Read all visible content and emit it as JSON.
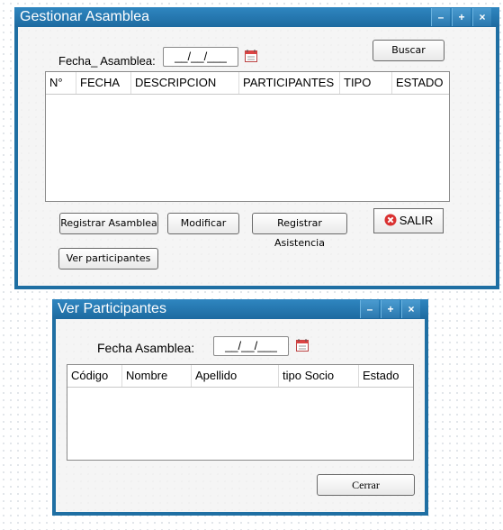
{
  "gestionar": {
    "title": "Gestionar Asamblea",
    "fecha_label": "Fecha_ Asamblea:",
    "fecha_value": "__/__/___",
    "buscar": "Buscar",
    "columns": [
      "N°",
      "FECHA",
      "DESCRIPCION",
      "PARTICIPANTES",
      "TIPO",
      "ESTADO"
    ],
    "btn_registrar_asamblea": "Registrar Asamblea",
    "btn_modificar": "Modificar",
    "btn_registrar_asistencia": "Registrar Asistencia",
    "btn_salir": "SALIR",
    "btn_ver_participantes": "Ver participantes"
  },
  "ver": {
    "title": "Ver Participantes",
    "fecha_label": "Fecha Asamblea:",
    "fecha_value": "__/__/___",
    "columns": [
      "Código",
      "Nombre",
      "Apellido",
      "tipo Socio",
      "Estado"
    ],
    "btn_cerrar": "Cerrar"
  },
  "window_controls": {
    "minimize": "–",
    "maximize": "+",
    "close": "×"
  },
  "colors": {
    "titlebar": "#1f6fa3",
    "salir_icon": "#d93030"
  }
}
